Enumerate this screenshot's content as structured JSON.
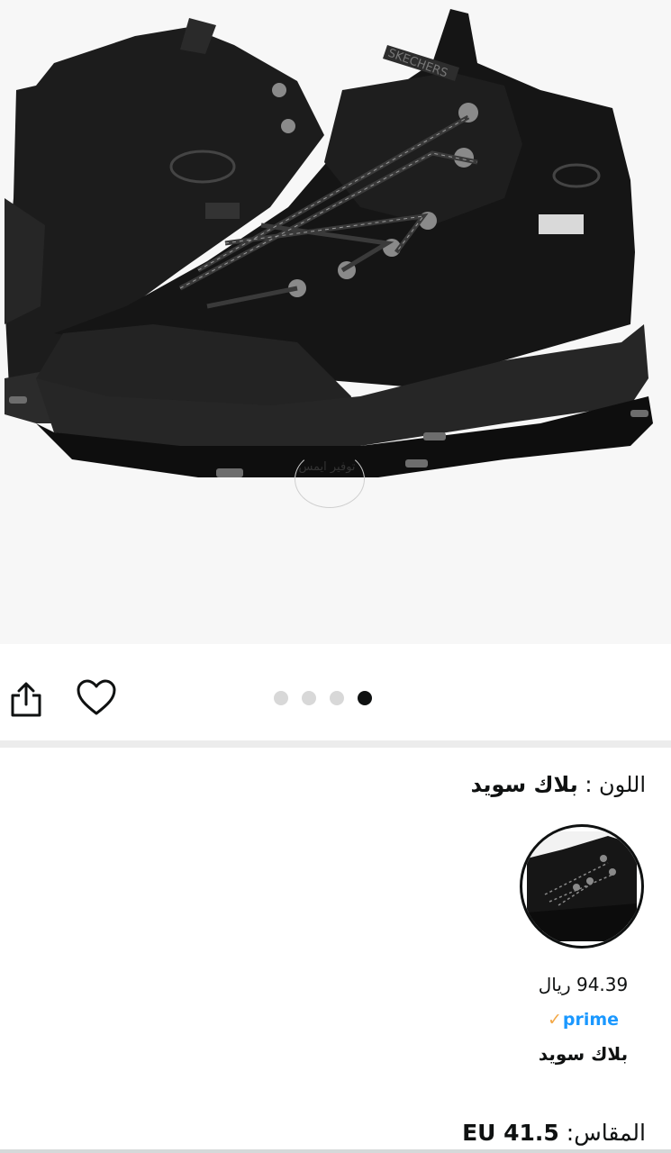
{
  "product_image": {
    "watermark_text": "توفير ايمس",
    "image_dots": {
      "count": 4,
      "active_index": 4
    }
  },
  "actions": {
    "share_icon": "share-icon",
    "favorite_icon": "heart-icon"
  },
  "color": {
    "label": "اللون : ",
    "value": "بلاك سويد"
  },
  "swatch": {
    "price": "94.39 ريال",
    "prime_check": "✓",
    "prime_label": "prime",
    "name": "بلاك سويد"
  },
  "size": {
    "label": "المقاس: ",
    "value": "EU 41.5"
  },
  "colors": {
    "prime_blue": "#1a98ff",
    "prime_check": "#f3a847",
    "text": "#0f1111",
    "divider": "#ececec"
  }
}
